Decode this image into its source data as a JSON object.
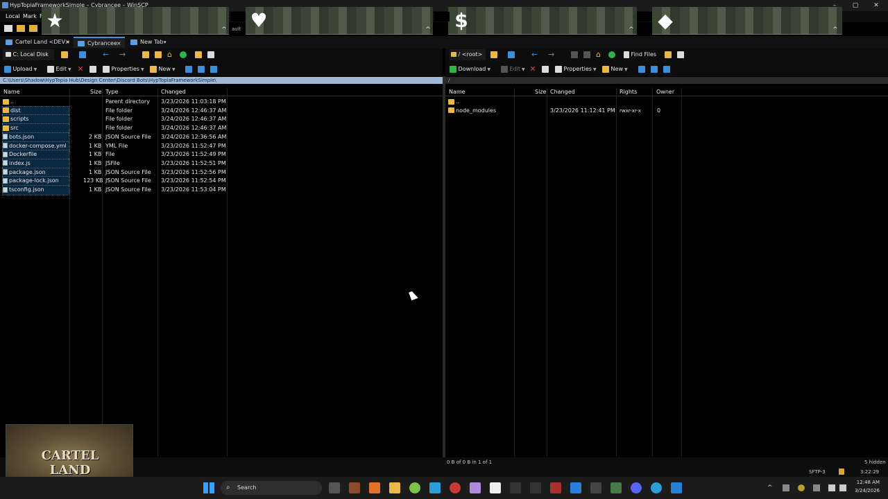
{
  "window": {
    "title": "HypTopiaFrameworkSimple – Cybrancee – WinSCP",
    "min": "–",
    "max": "▢",
    "close": "✕"
  },
  "menu": {
    "items": [
      "Local",
      "Mark",
      "Fi"
    ]
  },
  "banner": {
    "partial_text": "ault",
    "glyphs": [
      "★",
      "♥",
      "$",
      "◆"
    ],
    "caret": "^"
  },
  "tabs": [
    {
      "label": "Cartel Land <DEV>",
      "close": "×"
    },
    {
      "label": "Cybrancee",
      "close": "×"
    },
    {
      "label": "New Tab",
      "dropdown": "▾"
    }
  ],
  "left": {
    "drive": "C: Local Disk",
    "toolbar": {
      "upload": "Upload",
      "edit": "Edit",
      "properties": "Properties",
      "new": "New"
    },
    "path": "C:\\Users\\Shadow\\HypTopia Hub\\Design Center\\Discord Bots\\HypTopiaFrameworkSimple\\",
    "columns": {
      "name": "Name",
      "size": "Size",
      "type": "Type",
      "changed": "Changed"
    },
    "rows": [
      {
        "name": "..",
        "size": "",
        "type": "Parent directory",
        "changed": "3/23/2026 11:03:18 PM",
        "icon": "up"
      },
      {
        "name": "dist",
        "size": "",
        "type": "File folder",
        "changed": "3/24/2026 12:46:37 AM",
        "icon": "folder"
      },
      {
        "name": "scripts",
        "size": "",
        "type": "File folder",
        "changed": "3/24/2026 12:46:37 AM",
        "icon": "folder"
      },
      {
        "name": "src",
        "size": "",
        "type": "File folder",
        "changed": "3/24/2026 12:46:37 AM",
        "icon": "folder"
      },
      {
        "name": "bots.json",
        "size": "2 KB",
        "type": "JSON Source File",
        "changed": "3/24/2026 12:36:56 AM",
        "icon": "file"
      },
      {
        "name": "docker-compose.yml",
        "size": "1 KB",
        "type": "YML File",
        "changed": "3/23/2026 11:52:47 PM",
        "icon": "file"
      },
      {
        "name": "Dockerfile",
        "size": "1 KB",
        "type": "File",
        "changed": "3/23/2026 11:52:49 PM",
        "icon": "file"
      },
      {
        "name": "index.js",
        "size": "1 KB",
        "type": "JSFile",
        "changed": "3/23/2026 11:52:51 PM",
        "icon": "file"
      },
      {
        "name": "package.json",
        "size": "1 KB",
        "type": "JSON Source File",
        "changed": "3/23/2026 11:52:56 PM",
        "icon": "file"
      },
      {
        "name": "package-lock.json",
        "size": "123 KB",
        "type": "JSON Source File",
        "changed": "3/23/2026 11:52:54 PM",
        "icon": "file"
      },
      {
        "name": "tsconfig.json",
        "size": "1 KB",
        "type": "JSON Source File",
        "changed": "3/23/2026 11:53:04 PM",
        "icon": "file"
      }
    ]
  },
  "right": {
    "drive": "/ <root>",
    "find_files": "Find Files",
    "toolbar": {
      "download": "Download",
      "edit": "Edit",
      "properties": "Properties",
      "new": "New"
    },
    "path": "/",
    "columns": {
      "name": "Name",
      "size": "Size",
      "changed": "Changed",
      "rights": "Rights",
      "owner": "Owner"
    },
    "rows": [
      {
        "name": "..",
        "size": "",
        "changed": "",
        "rights": "",
        "owner": "",
        "icon": "up"
      },
      {
        "name": "node_modules",
        "size": "",
        "changed": "3/23/2026 11:12:41 PM",
        "rights": "rwxr-xr-x",
        "owner": "0",
        "icon": "folder"
      }
    ],
    "status": "0 B of 0 B in 1 of 1",
    "hidden": "5 hidden"
  },
  "status": {
    "protocol": "SFTP-3",
    "elapsed": "3:22:29"
  },
  "webcam": {
    "logo": "CARTEL LAND"
  },
  "taskbar": {
    "search": "Search",
    "time": "12:48 AM",
    "date": "3/24/2026"
  }
}
